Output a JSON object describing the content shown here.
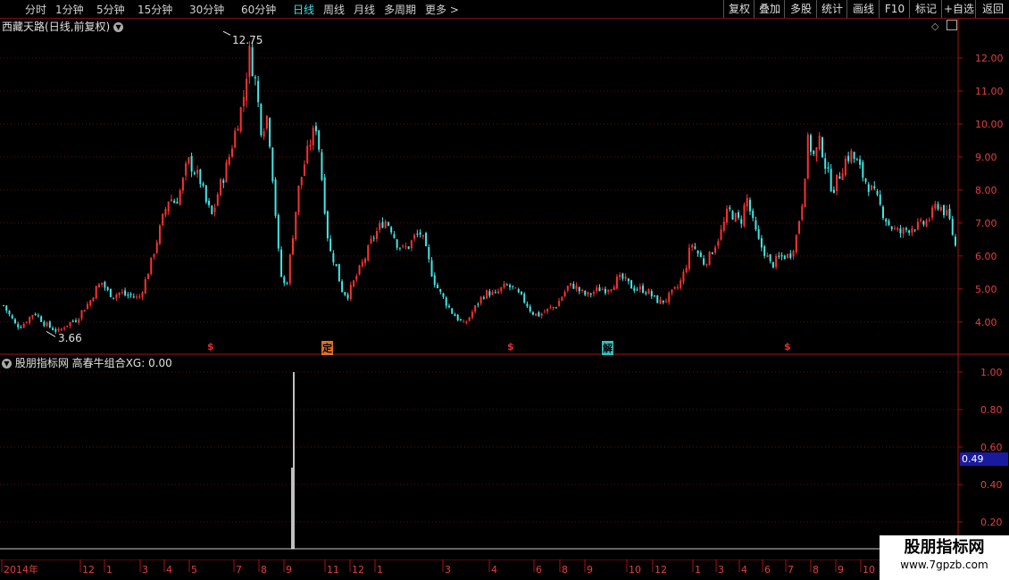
{
  "toolbar": {
    "periods": [
      "分时",
      "1分钟",
      "5分钟",
      "15分钟",
      "30分钟",
      "60分钟",
      "日线",
      "周线",
      "月线",
      "多周期",
      "更多"
    ],
    "active_period": "日线",
    "right_buttons": [
      "复权",
      "叠加",
      "多股",
      "统计",
      "画线",
      "F10",
      "标记",
      "+自选",
      "返回"
    ]
  },
  "main": {
    "stock_name": "西藏天路",
    "mode": "(日线,前复权)",
    "high_label": "12.75",
    "low_label": "3.66",
    "y_axis": [
      "12.00",
      "11.00",
      "10.00",
      "9.00",
      "8.00",
      "7.00",
      "6.00",
      "5.00",
      "4.00"
    ],
    "markers": [
      {
        "text": "$",
        "color": "#e03030"
      },
      {
        "text": "定",
        "color": "#e07020"
      },
      {
        "text": "$",
        "color": "#e03030"
      },
      {
        "text": "解",
        "color": "#30c0c0"
      },
      {
        "text": "$",
        "color": "#e03030"
      }
    ]
  },
  "indicator": {
    "source": "股朋指标网",
    "name": "高春牛组合",
    "value_label": "XG: 0.00",
    "y_axis": [
      "1.00",
      "0.80",
      "0.60",
      "0.40",
      "0.20"
    ],
    "current_value": "0.49"
  },
  "date_axis": {
    "labels": [
      "2014年",
      "12",
      "1",
      "3",
      "4",
      "5",
      "7",
      "8",
      "9",
      "11",
      "12",
      "1",
      "3",
      "4",
      "6",
      "8",
      "9",
      "10",
      "12",
      "1",
      "3",
      "4",
      "6",
      "7",
      "8",
      "9",
      "10"
    ]
  },
  "watermark": {
    "line1": "股朋指标网",
    "line2": "www.7gpzb.com"
  },
  "chart_data": {
    "type": "candlestick",
    "ylim": [
      3.4,
      13.0
    ],
    "max": 12.75,
    "min": 3.66,
    "close_path": [
      4.5,
      4.2,
      3.9,
      3.9,
      4.1,
      4.3,
      4.1,
      3.9,
      3.8,
      3.7,
      3.9,
      4.0,
      4.1,
      4.4,
      4.6,
      5.0,
      5.2,
      4.9,
      4.8,
      4.9,
      4.8,
      4.8,
      4.7,
      5.2,
      5.8,
      6.5,
      7.2,
      7.8,
      7.6,
      8.1,
      8.9,
      8.6,
      8.3,
      7.6,
      7.2,
      8.0,
      8.5,
      9.2,
      10.0,
      10.7,
      12.2,
      11.3,
      9.8,
      10.3,
      8.0,
      5.5,
      5.0,
      6.5,
      8.0,
      8.8,
      9.5,
      10.0,
      8.0,
      6.2,
      5.8,
      5.0,
      4.8,
      5.2,
      5.6,
      6.0,
      6.5,
      6.8,
      7.1,
      6.9,
      6.4,
      6.2,
      6.3,
      6.6,
      6.7,
      6.0,
      5.3,
      4.9,
      4.6,
      4.3,
      4.1,
      3.9,
      4.2,
      4.5,
      4.8,
      4.9,
      4.8,
      5.0,
      5.1,
      5.0,
      4.8,
      4.6,
      4.3,
      4.2,
      4.3,
      4.4,
      4.5,
      4.8,
      5.1,
      5.1,
      4.9,
      4.8,
      4.9,
      5.0,
      5.0,
      5.1,
      5.3,
      5.3,
      5.1,
      5.0,
      5.0,
      4.9,
      4.7,
      4.6,
      4.7,
      4.9,
      5.1,
      5.6,
      6.4,
      6.1,
      5.8,
      6.0,
      6.4,
      6.8,
      7.4,
      7.2,
      7.0,
      7.8,
      7.0,
      6.4,
      6.1,
      5.7,
      5.9,
      6.0,
      6.0,
      6.5,
      7.6,
      9.5,
      9.0,
      9.5,
      8.6,
      8.0,
      8.4,
      8.9,
      9.1,
      8.8,
      8.4,
      8.1,
      7.8,
      7.4,
      7.0,
      6.8,
      6.7,
      6.8,
      6.9,
      6.9,
      7.0,
      7.2,
      7.6,
      7.4,
      7.1,
      6.3
    ]
  }
}
